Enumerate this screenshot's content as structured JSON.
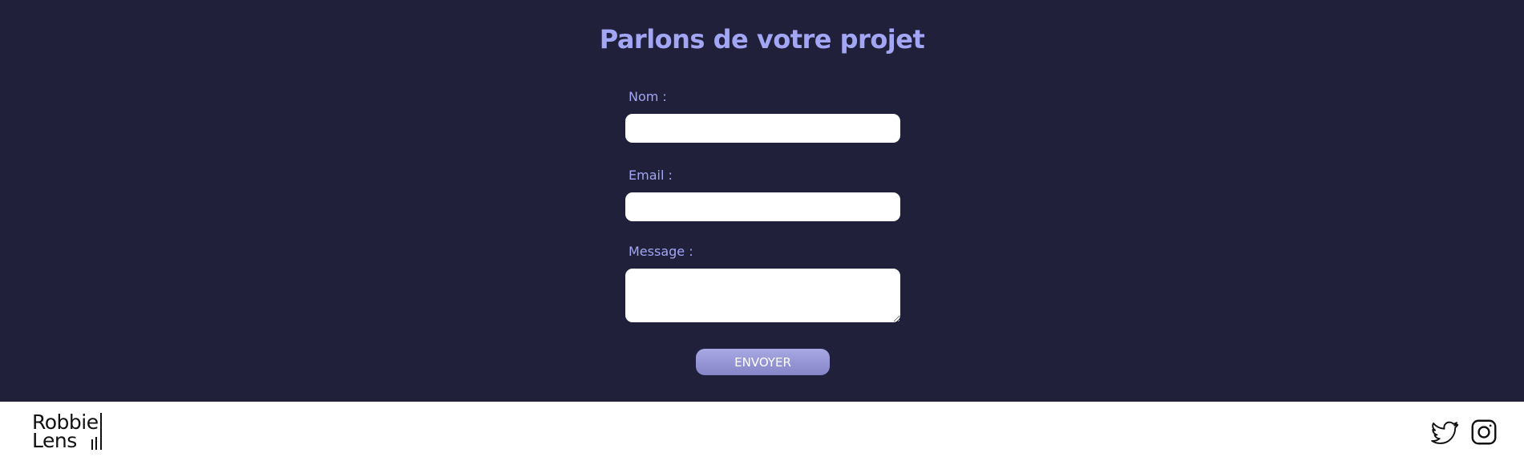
{
  "contact": {
    "title": "Parlons de votre projet",
    "fields": {
      "name_label": "Nom :",
      "name_value": "",
      "email_label": "Email :",
      "email_value": "",
      "message_label": "Message :",
      "message_value": ""
    },
    "submit_label": "ENVOYER"
  },
  "footer": {
    "logo": {
      "line1": "Robbie",
      "line2": "Lens"
    },
    "social": [
      "twitter-icon",
      "instagram-icon"
    ]
  },
  "colors": {
    "background": "#20203a",
    "accent": "#a3a6f5",
    "button": "#9a9ad8"
  }
}
